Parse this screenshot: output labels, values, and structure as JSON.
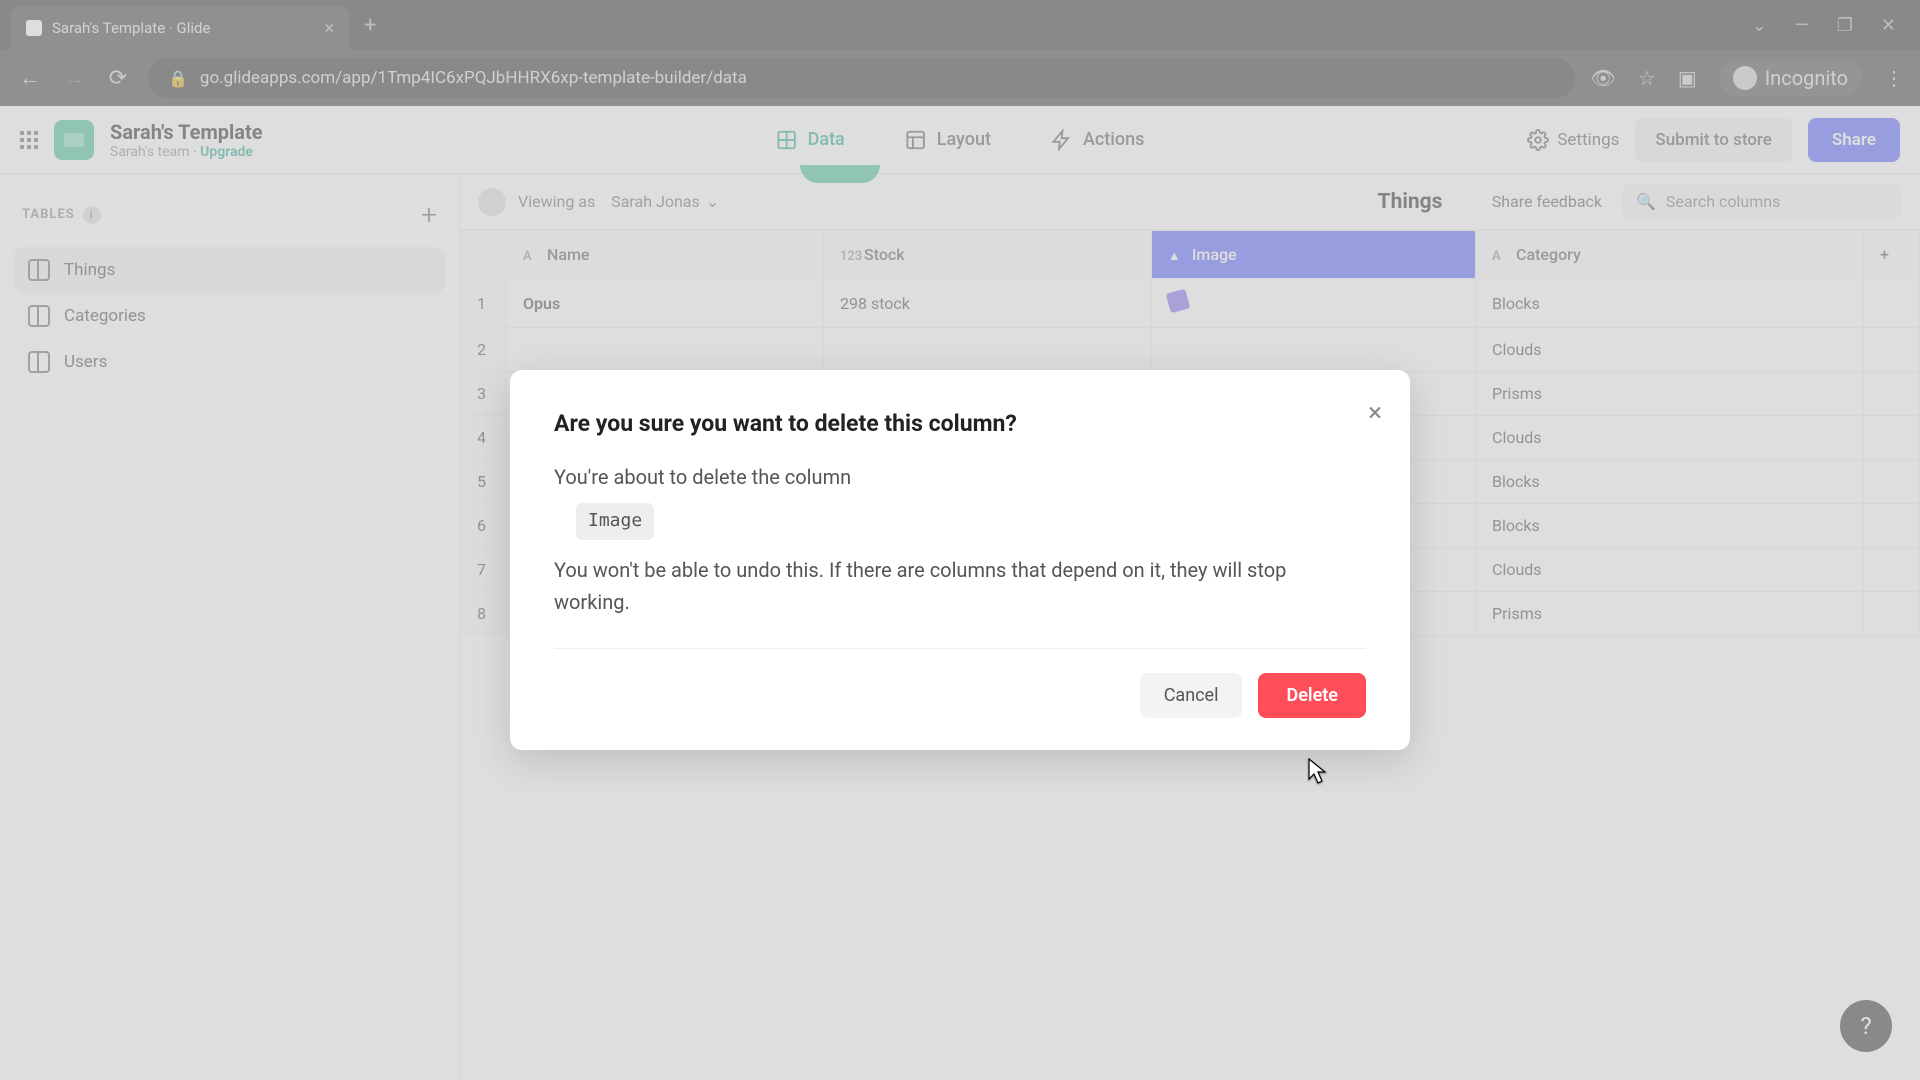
{
  "browser": {
    "tab_title": "Sarah's Template · Glide",
    "url": "go.glideapps.com/app/1Tmp4IC6xPQJbHHRX6xp-template-builder/data",
    "incognito_label": "Incognito"
  },
  "header": {
    "app_title": "Sarah's Template",
    "team_name": "Sarah's team",
    "upgrade_label": "Upgrade",
    "tabs": {
      "data": "Data",
      "layout": "Layout",
      "actions": "Actions"
    },
    "settings": "Settings",
    "submit": "Submit to store",
    "share": "Share"
  },
  "sidebar": {
    "section_title": "TABLES",
    "items": [
      {
        "label": "Things"
      },
      {
        "label": "Categories"
      },
      {
        "label": "Users"
      }
    ]
  },
  "topbar": {
    "viewing_prefix": "Viewing as",
    "viewing_user": "Sarah Jonas",
    "table_title": "Things",
    "share_feedback": "Share feedback",
    "search_placeholder": "Search columns"
  },
  "columns": {
    "name": "Name",
    "stock": "Stock",
    "image": "Image",
    "category": "Category"
  },
  "rows": [
    {
      "n": "1",
      "name": "Opus",
      "stock": "298 stock",
      "category": "Blocks"
    },
    {
      "n": "2",
      "name": "",
      "stock": "",
      "category": "Clouds"
    },
    {
      "n": "3",
      "name": "",
      "stock": "",
      "category": "Prisms"
    },
    {
      "n": "4",
      "name": "",
      "stock": "",
      "category": "Clouds"
    },
    {
      "n": "5",
      "name": "",
      "stock": "",
      "category": "Blocks"
    },
    {
      "n": "6",
      "name": "",
      "stock": "",
      "category": "Blocks"
    },
    {
      "n": "7",
      "name": "",
      "stock": "",
      "category": "Clouds"
    },
    {
      "n": "8",
      "name": "",
      "stock": "",
      "category": "Prisms"
    }
  ],
  "modal": {
    "title": "Are you sure you want to delete this column?",
    "line1": "You're about to delete the column",
    "chip": "Image",
    "line2": "You won't be able to undo this. If there are columns that depend on it, they will stop working.",
    "cancel": "Cancel",
    "delete": "Delete"
  },
  "help": "?"
}
